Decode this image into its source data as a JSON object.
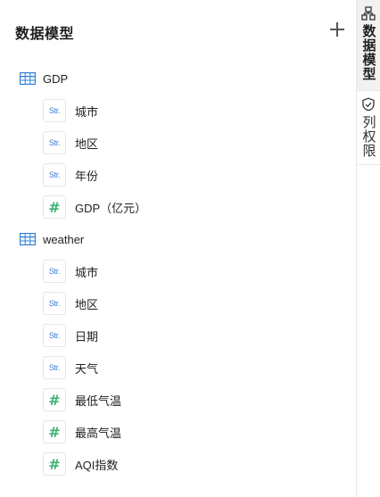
{
  "panel": {
    "title": "数据模型",
    "add_icon": "plus-icon"
  },
  "tables": [
    {
      "name": "GDP",
      "icon": "table-icon",
      "fields": [
        {
          "type": "Str.",
          "icon": "string-type-icon",
          "label": "城市"
        },
        {
          "type": "Str.",
          "icon": "string-type-icon",
          "label": "地区"
        },
        {
          "type": "Str.",
          "icon": "string-type-icon",
          "label": "年份"
        },
        {
          "type": "#",
          "icon": "number-type-icon",
          "label": "GDP（亿元）"
        }
      ]
    },
    {
      "name": "weather",
      "icon": "table-icon",
      "fields": [
        {
          "type": "Str.",
          "icon": "string-type-icon",
          "label": "城市"
        },
        {
          "type": "Str.",
          "icon": "string-type-icon",
          "label": "地区"
        },
        {
          "type": "Str.",
          "icon": "string-type-icon",
          "label": "日期"
        },
        {
          "type": "Str.",
          "icon": "string-type-icon",
          "label": "天气"
        },
        {
          "type": "#",
          "icon": "number-type-icon",
          "label": "最低气温"
        },
        {
          "type": "#",
          "icon": "number-type-icon",
          "label": "最高气温"
        },
        {
          "type": "#",
          "icon": "number-type-icon",
          "label": "AQI指数"
        }
      ]
    }
  ],
  "side_tabs": [
    {
      "label": "数据模型",
      "icon": "hierarchy-icon",
      "active": true
    },
    {
      "label": "列权限",
      "icon": "shield-check-icon",
      "active": false
    }
  ],
  "colors": {
    "string_type": "#3b7fd6",
    "number_type": "#3cb371",
    "table_icon": "#2f7fd8"
  }
}
